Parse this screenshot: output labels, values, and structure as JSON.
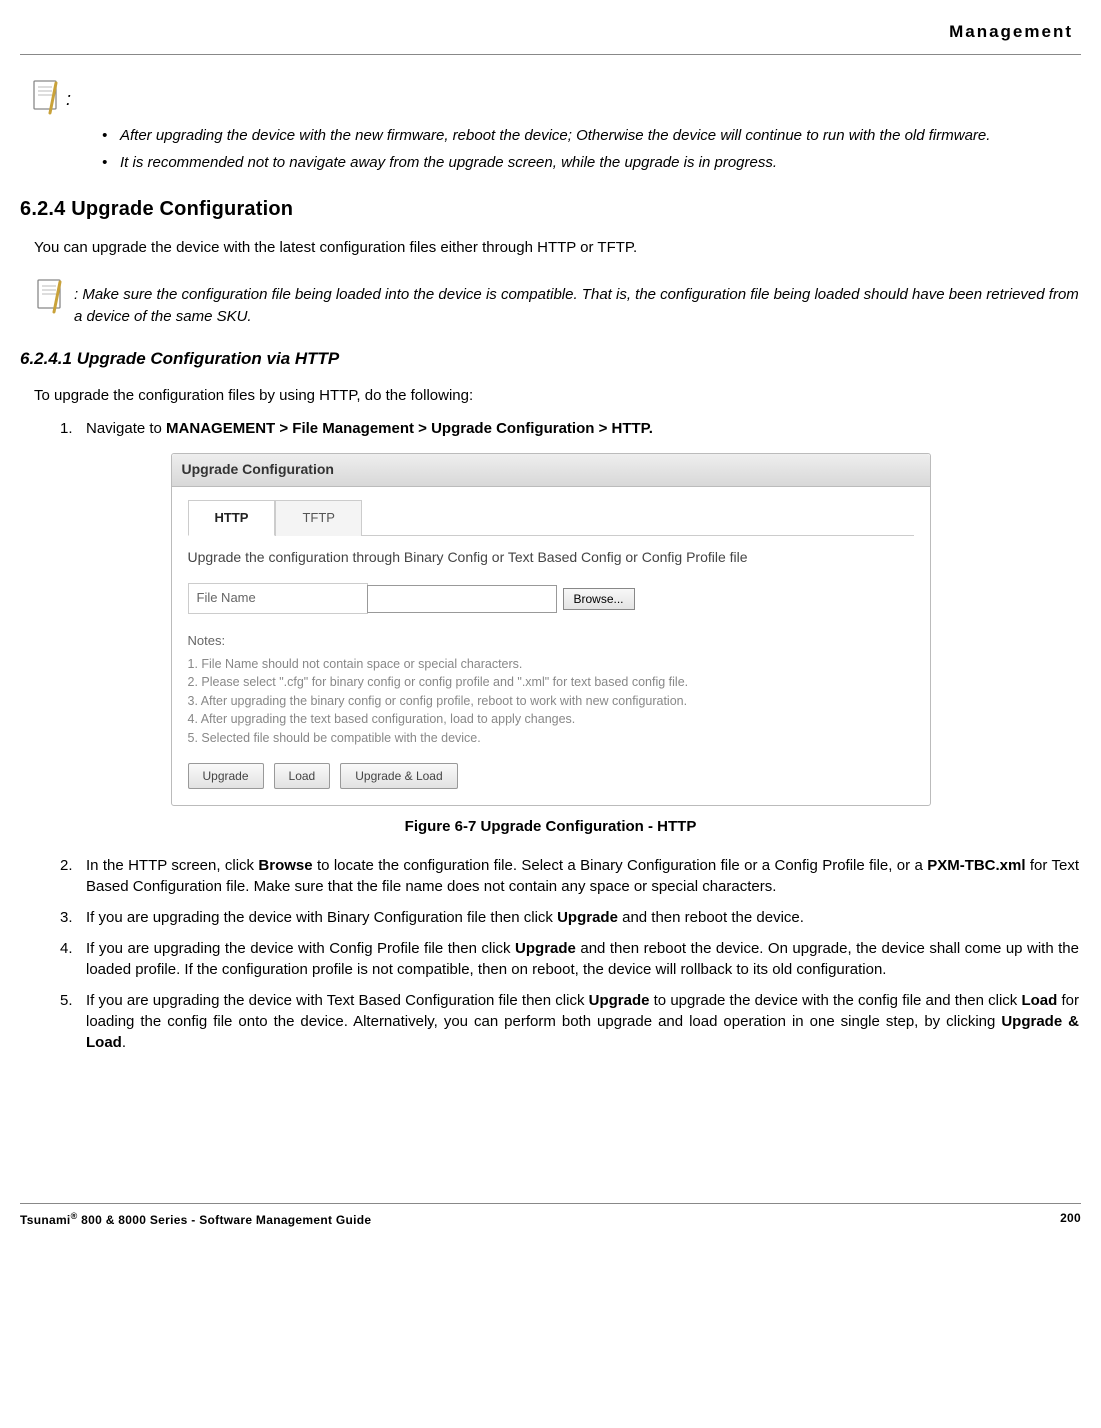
{
  "header": {
    "title": "Management"
  },
  "note_top": {
    "items": [
      "After upgrading the device with the new firmware, reboot the device; Otherwise the device will continue to run with the old firmware.",
      "It is recommended not to navigate away from the upgrade screen, while the upgrade is in progress."
    ]
  },
  "section": {
    "heading": "6.2.4 Upgrade Configuration",
    "intro": "You can upgrade the device with the latest configuration files either through HTTP or TFTP."
  },
  "note_inline": {
    "prefix": ": ",
    "text": "Make sure the configuration file being loaded into the device is compatible. That is, the configuration file being loaded should have been retrieved from a device of the same SKU."
  },
  "subsection": {
    "heading": "6.2.4.1 Upgrade Configuration via HTTP",
    "intro": "To upgrade the configuration files by using HTTP, do the following:"
  },
  "steps": {
    "s1_pre": "Navigate to ",
    "s1_bold": "MANAGEMENT > File Management > Upgrade Configuration > HTTP.",
    "s2_a": "In the HTTP screen, click ",
    "s2_b": "Browse",
    "s2_c": " to locate the configuration file. Select a Binary Configuration file or a Config Profile file, or a ",
    "s2_d": "PXM-TBC.xml",
    "s2_e": " for Text Based Configuration file. Make sure that the file name does not contain any space or special characters.",
    "s3_a": "If you are upgrading the device with Binary Configuration file then click ",
    "s3_b": "Upgrade",
    "s3_c": " and then reboot the device.",
    "s4_a": "If you are upgrading the device with Config Profile file then click ",
    "s4_b": "Upgrade",
    "s4_c": " and then reboot the device. On upgrade, the device shall come up with the loaded profile. If the configuration profile is not compatible, then on reboot, the device will rollback to its old configuration.",
    "s5_a": "If you are upgrading the device with Text Based Configuration file then click ",
    "s5_b": "Upgrade",
    "s5_c": " to upgrade the device with the config file and then click ",
    "s5_d": "Load",
    "s5_e": " for loading the config file onto the device. Alternatively, you can perform both upgrade and load operation in one single step, by clicking ",
    "s5_f": "Upgrade & Load",
    "s5_g": "."
  },
  "panel": {
    "title": "Upgrade Configuration",
    "tab_http": "HTTP",
    "tab_tftp": "TFTP",
    "instruction": "Upgrade the configuration through Binary Config or Text Based Config or Config Profile file",
    "file_label": "File Name",
    "browse": "Browse...",
    "notes_label": "Notes:",
    "notes": [
      "1. File Name should not contain space or special characters.",
      "2. Please select \".cfg\" for binary config or config profile and \".xml\" for text based config file.",
      "3. After upgrading the binary config or config profile, reboot to work with new configuration.",
      "4. After upgrading the text based configuration, load to apply changes.",
      "5. Selected file should be compatible with the device."
    ],
    "btn_upgrade": "Upgrade",
    "btn_load": "Load",
    "btn_upgrade_load": "Upgrade & Load"
  },
  "figure_caption": "Figure 6-7 Upgrade Configuration - HTTP",
  "footer": {
    "left_pre": "Tsunami",
    "left_post": " 800 & 8000 Series - Software Management Guide",
    "page": "200"
  }
}
